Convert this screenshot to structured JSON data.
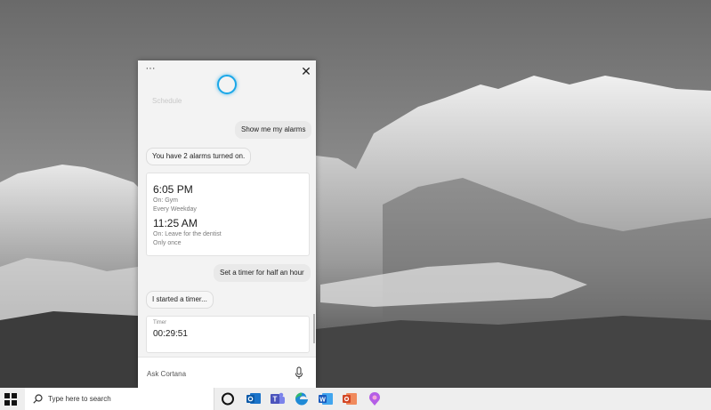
{
  "panel": {
    "faded_text": "Schedule",
    "close_glyph": "✕",
    "more_glyph": "···",
    "messages": {
      "user_1": "Show me my alarms",
      "bot_1": "You have 2 alarms turned on.",
      "user_2": "Set a timer for half an hour",
      "bot_2": "I started a timer..."
    },
    "alarms": [
      {
        "time": "6:05 PM",
        "label": "On: Gym",
        "repeat": "Every Weekday"
      },
      {
        "time": "11:25 AM",
        "label": "On: Leave for the dentist",
        "repeat": "Only once"
      }
    ],
    "timer": {
      "label": "Timer",
      "value": "00:29:51"
    },
    "ask": {
      "placeholder": "Ask Cortana"
    }
  },
  "taskbar": {
    "search_text": "Type here to search",
    "apps": [
      "cortana-icon",
      "outlook-icon",
      "teams-icon",
      "edge-icon",
      "word-icon",
      "office-icon",
      "paint-icon"
    ]
  },
  "colors": {
    "accent": "#1aa7e8",
    "panel_bg": "#f3f3f3",
    "taskbar_bg": "#eeeeee"
  }
}
